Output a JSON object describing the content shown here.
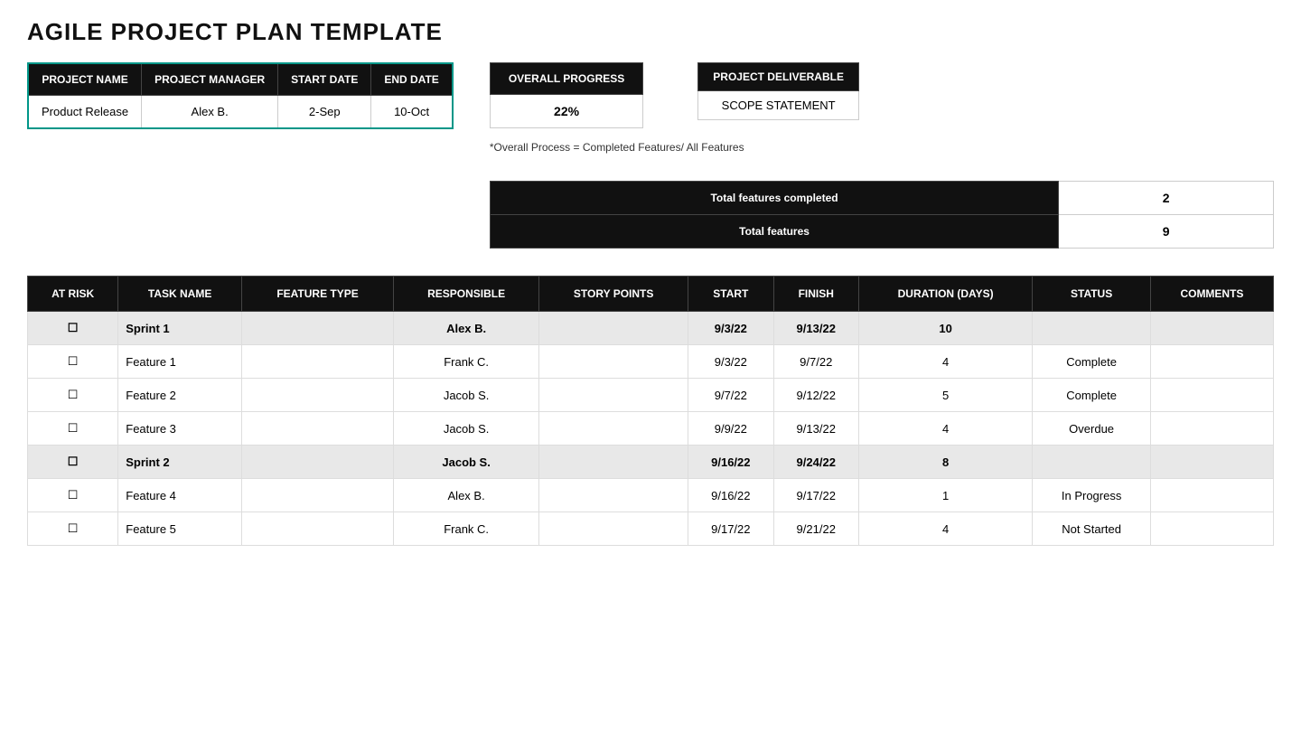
{
  "title": "AGILE PROJECT PLAN TEMPLATE",
  "project_table": {
    "headers": [
      "PROJECT NAME",
      "PROJECT MANAGER",
      "START DATE",
      "END DATE"
    ],
    "row": {
      "name": "Product Release",
      "manager": "Alex B.",
      "start": "2-Sep",
      "end": "10-Oct"
    }
  },
  "overall_progress": {
    "label": "OVERALL PROGRESS",
    "value": "22%"
  },
  "deliverable_table": {
    "rows": [
      "PROJECT DELIVERABLE",
      "SCOPE STATEMENT"
    ]
  },
  "formula_note": "*Overall Process = Completed Features/ All Features",
  "totals": [
    {
      "label": "Total features completed",
      "value": "2"
    },
    {
      "label": "Total features",
      "value": "9"
    }
  ],
  "task_table": {
    "headers": [
      "AT RISK",
      "TASK NAME",
      "FEATURE TYPE",
      "RESPONSIBLE",
      "STORY POINTS",
      "START",
      "FINISH",
      "DURATION (DAYS)",
      "STATUS",
      "COMMENTS"
    ],
    "rows": [
      {
        "type": "sprint",
        "at_risk": "☐",
        "task": "Sprint 1",
        "feature_type": "",
        "responsible": "Alex B.",
        "story_points": "",
        "start": "9/3/22",
        "finish": "9/13/22",
        "duration": "10",
        "status": "",
        "comments": ""
      },
      {
        "type": "feature",
        "at_risk": "☐",
        "task": "Feature 1",
        "feature_type": "",
        "responsible": "Frank C.",
        "story_points": "",
        "start": "9/3/22",
        "finish": "9/7/22",
        "duration": "4",
        "status": "Complete",
        "comments": ""
      },
      {
        "type": "feature",
        "at_risk": "☐",
        "task": "Feature 2",
        "feature_type": "",
        "responsible": "Jacob S.",
        "story_points": "",
        "start": "9/7/22",
        "finish": "9/12/22",
        "duration": "5",
        "status": "Complete",
        "comments": ""
      },
      {
        "type": "feature",
        "at_risk": "☐",
        "task": "Feature 3",
        "feature_type": "",
        "responsible": "Jacob S.",
        "story_points": "",
        "start": "9/9/22",
        "finish": "9/13/22",
        "duration": "4",
        "status": "Overdue",
        "comments": ""
      },
      {
        "type": "sprint",
        "at_risk": "☐",
        "task": "Sprint 2",
        "feature_type": "",
        "responsible": "Jacob S.",
        "story_points": "",
        "start": "9/16/22",
        "finish": "9/24/22",
        "duration": "8",
        "status": "",
        "comments": ""
      },
      {
        "type": "feature",
        "at_risk": "☐",
        "task": "Feature 4",
        "feature_type": "",
        "responsible": "Alex B.",
        "story_points": "",
        "start": "9/16/22",
        "finish": "9/17/22",
        "duration": "1",
        "status": "In Progress",
        "comments": ""
      },
      {
        "type": "feature",
        "at_risk": "☐",
        "task": "Feature 5",
        "feature_type": "",
        "responsible": "Frank C.",
        "story_points": "",
        "start": "9/17/22",
        "finish": "9/21/22",
        "duration": "4",
        "status": "Not Started",
        "comments": ""
      }
    ]
  }
}
